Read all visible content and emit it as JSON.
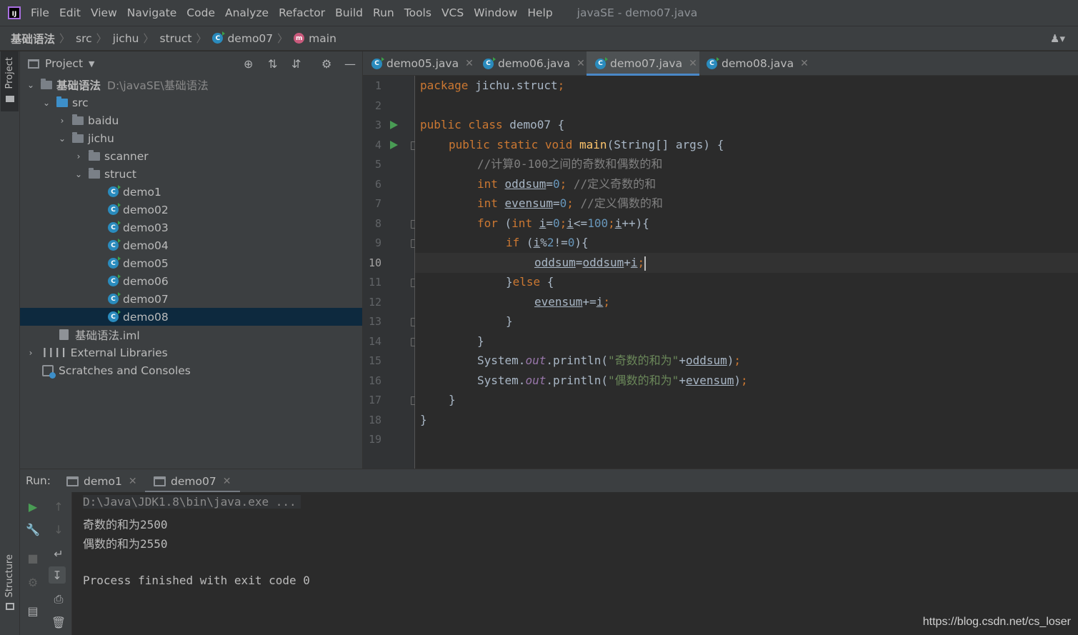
{
  "menu": {
    "items": [
      "File",
      "Edit",
      "View",
      "Navigate",
      "Code",
      "Analyze",
      "Refactor",
      "Build",
      "Run",
      "Tools",
      "VCS",
      "Window",
      "Help"
    ],
    "window_title": "javaSE - demo07.java"
  },
  "breadcrumbs": [
    "基础语法",
    "src",
    "jichu",
    "struct",
    "demo07",
    "main"
  ],
  "left_strip": {
    "project": "Project",
    "structure": "Structure"
  },
  "project_panel": {
    "title": "Project",
    "tree": [
      {
        "label": "基础语法",
        "hint": "D:\\javaSE\\基础语法"
      },
      {
        "label": "src"
      },
      {
        "label": "baidu"
      },
      {
        "label": "jichu"
      },
      {
        "label": "scanner"
      },
      {
        "label": "struct"
      },
      {
        "label": "demo1"
      },
      {
        "label": "demo02"
      },
      {
        "label": "demo03"
      },
      {
        "label": "demo04"
      },
      {
        "label": "demo05"
      },
      {
        "label": "demo06"
      },
      {
        "label": "demo07"
      },
      {
        "label": "demo08"
      },
      {
        "label": "基础语法.iml"
      },
      {
        "label": "External Libraries"
      },
      {
        "label": "Scratches and Consoles"
      }
    ]
  },
  "editor": {
    "tabs": [
      {
        "label": "demo05.java",
        "active": false
      },
      {
        "label": "demo06.java",
        "active": false
      },
      {
        "label": "demo07.java",
        "active": true
      },
      {
        "label": "demo08.java",
        "active": false
      }
    ],
    "line_numbers": [
      "1",
      "2",
      "3",
      "4",
      "5",
      "6",
      "7",
      "8",
      "9",
      "10",
      "11",
      "12",
      "13",
      "14",
      "15",
      "16",
      "17",
      "18",
      "19"
    ],
    "current_line": "10",
    "code": {
      "l1_kw": "package",
      "l1_rest": " jichu.struct",
      "l1_semi": ";",
      "l3_kw": "public class",
      "l3_rest": " demo07 {",
      "l4_kw": "public static void",
      "l4_fn": "main",
      "l4_rest": "(String[] args) {",
      "l5_comment": "//计算0-100之间的奇数和偶数的和",
      "l6_kw": "int",
      "l6_var": "oddsum",
      "l6_eq": "=",
      "l6_num": "0",
      "l6_semi": ";",
      "l6_comment": "//定义奇数的和",
      "l7_kw": "int",
      "l7_var": "evensum",
      "l7_eq": "=",
      "l7_num": "0",
      "l7_semi": ";",
      "l7_comment": "//定义偶数的和",
      "l8_kw": "for",
      "l8_paren": " (",
      "l8_kw2": "int",
      "l8_i1": "i",
      "l8_eq": "=",
      "l8_n1": "0",
      "l8_s1": ";",
      "l8_i2": "i",
      "l8_le": "<=",
      "l8_n2": "100",
      "l8_s2": ";",
      "l8_i3": "i",
      "l8_end": "++){",
      "l9_kw": "if",
      "l9_open": " (",
      "l9_i": "i",
      "l9_mod": "%",
      "l9_n1": "2",
      "l9_ne": "!=",
      "l9_n2": "0",
      "l9_close": "){",
      "l10_var1": "oddsum",
      "l10_eq": "=",
      "l10_var2": "oddsum",
      "l10_plus": "+",
      "l10_i": "i",
      "l10_semi": ";",
      "l11_brace": "}",
      "l11_kw": "else",
      "l11_rest": " {",
      "l12_var": "evensum",
      "l12_op": "+=",
      "l12_i": "i",
      "l12_semi": ";",
      "l13": "}",
      "l14": "}",
      "l15_sys": "System.",
      "l15_out": "out",
      "l15_call": ".println(",
      "l15_str": "\"奇数的和为\"",
      "l15_plus": "+",
      "l15_var": "oddsum",
      "l15_close": ")",
      "l15_semi": ";",
      "l16_sys": "System.",
      "l16_out": "out",
      "l16_call": ".println(",
      "l16_str": "\"偶数的和为\"",
      "l16_plus": "+",
      "l16_var": "evensum",
      "l16_close": ")",
      "l16_semi": ";",
      "l17": "}",
      "l18": "}"
    }
  },
  "run_panel": {
    "label": "Run:",
    "tabs": [
      {
        "label": "demo1",
        "active": false
      },
      {
        "label": "demo07",
        "active": true
      }
    ],
    "console": [
      "D:\\Java\\JDK1.8\\bin\\java.exe ...",
      "奇数的和为2500",
      "偶数的和为2550",
      "Process finished with exit code 0"
    ]
  },
  "watermark": "https://blog.csdn.net/cs_loser",
  "colors": {
    "background": "#2b2b2b",
    "panel": "#3c3f41",
    "keyword": "#cc7832",
    "number": "#6897bb",
    "comment": "#808080",
    "string": "#6a8759",
    "function": "#ffc66d",
    "static_field": "#9876aa",
    "selection": "#0d293e",
    "tab_underline": "#4a88c7",
    "run_green": "#499c54"
  }
}
